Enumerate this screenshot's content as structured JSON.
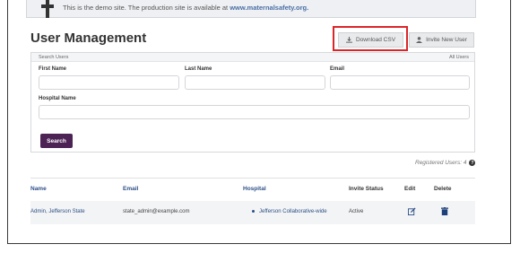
{
  "demo_banner": {
    "text": "This is the demo site. The production site is available at",
    "link": "www.maternalsafety.org."
  },
  "page_title": "User Management",
  "buttons": {
    "download_csv": "Download CSV",
    "invite_new_user": "Invite New User",
    "search": "Search"
  },
  "search_panel": {
    "title": "Search Users",
    "right_label": "All Users",
    "fields": {
      "first_name": {
        "label": "First Name",
        "value": ""
      },
      "last_name": {
        "label": "Last Name",
        "value": ""
      },
      "email": {
        "label": "Email",
        "value": ""
      },
      "hospital_name": {
        "label": "Hospital Name",
        "value": ""
      }
    }
  },
  "registered_users": "Registered Users: 4",
  "table": {
    "headers": {
      "name": "Name",
      "email": "Email",
      "hospital": "Hospital",
      "invite_status": "Invite Status",
      "edit": "Edit",
      "delete": "Delete"
    },
    "rows": [
      {
        "name": "Admin, Jefferson State",
        "email": "state_admin@example.com",
        "hospital": "Jefferson Collaborative-wide",
        "invite_status": "Active"
      }
    ]
  },
  "colors": {
    "search_button": "#4d2356",
    "link": "#2d4f86",
    "highlight": "#d9262b"
  },
  "icons": [
    "pin-icon",
    "download-icon",
    "user-icon",
    "help-icon",
    "edit-icon",
    "trash-icon"
  ]
}
